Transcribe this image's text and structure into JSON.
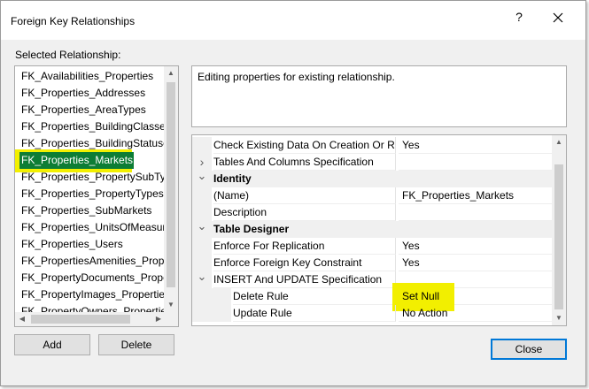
{
  "window": {
    "title": "Foreign Key Relationships",
    "help_glyph": "?"
  },
  "selected_relationship_label": "Selected Relationship:",
  "relationships": [
    "FK_Availabilities_Properties",
    "FK_Properties_Addresses",
    "FK_Properties_AreaTypes",
    "FK_Properties_BuildingClasses",
    "FK_Properties_BuildingStatuses",
    "FK_Properties_Markets",
    "FK_Properties_PropertySubTypes",
    "FK_Properties_PropertyTypes",
    "FK_Properties_SubMarkets",
    "FK_Properties_UnitsOfMeasure",
    "FK_Properties_Users",
    "FK_PropertiesAmenities_Properties",
    "FK_PropertyDocuments_Properties",
    "FK_PropertyImages_Properties",
    "FK_PropertyOwners_Properties"
  ],
  "selected_index": 5,
  "description": "Editing properties for existing relationship.",
  "properties": [
    {
      "type": "prop",
      "name": "Check Existing Data On Creation Or Re-Enabling",
      "value": "Yes",
      "expander": ""
    },
    {
      "type": "prop",
      "name": "Tables And Columns Specification",
      "value": "",
      "expander": "collapsed"
    },
    {
      "type": "category",
      "name": "Identity",
      "expander": "expanded"
    },
    {
      "type": "prop",
      "name": "(Name)",
      "value": "FK_Properties_Markets",
      "expander": ""
    },
    {
      "type": "prop",
      "name": "Description",
      "value": "",
      "expander": ""
    },
    {
      "type": "category",
      "name": "Table Designer",
      "expander": "expanded"
    },
    {
      "type": "prop",
      "name": "Enforce For Replication",
      "value": "Yes",
      "expander": ""
    },
    {
      "type": "prop",
      "name": "Enforce Foreign Key Constraint",
      "value": "Yes",
      "expander": ""
    },
    {
      "type": "prop",
      "name": "INSERT And UPDATE Specification",
      "value": "",
      "expander": "expanded"
    },
    {
      "type": "sub",
      "name": "Delete Rule",
      "value": "Set Null",
      "expander": ""
    },
    {
      "type": "sub",
      "name": "Update Rule",
      "value": "No Action",
      "expander": ""
    }
  ],
  "buttons": {
    "add": "Add",
    "delete": "Delete",
    "close": "Close"
  },
  "highlight_color": "#f2ef00",
  "selection_color": "#0d7d35"
}
